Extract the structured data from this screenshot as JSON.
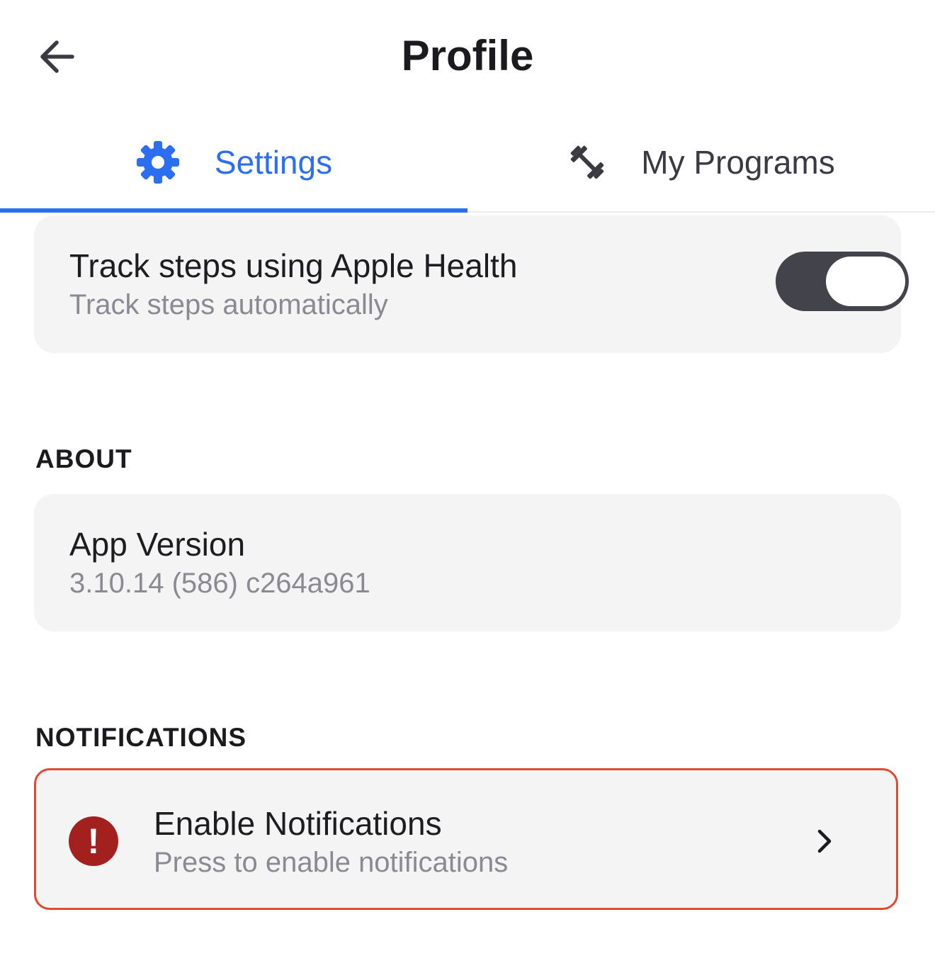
{
  "header": {
    "title": "Profile",
    "back_icon": "arrow-left-icon"
  },
  "tabs": [
    {
      "label": "Settings",
      "icon": "gear-icon",
      "active": true
    },
    {
      "label": "My Programs",
      "icon": "dumbbell-icon",
      "active": false
    }
  ],
  "steps_card": {
    "title": "Track steps using Apple Health",
    "subtitle": "Track steps automatically",
    "toggle_on": false
  },
  "about": {
    "section_label": "ABOUT",
    "title": "App Version",
    "value": "3.10.14 (586) c264a961"
  },
  "notifications": {
    "section_label": "NOTIFICATIONS",
    "title": "Enable Notifications",
    "subtitle": "Press to enable notifications",
    "alert_glyph": "!"
  },
  "colors": {
    "accent": "#2b6ef0",
    "alert_border": "#de4a33",
    "alert_icon": "#a3201f",
    "card_bg": "#f4f4f5",
    "toggle_track": "#42434b"
  }
}
